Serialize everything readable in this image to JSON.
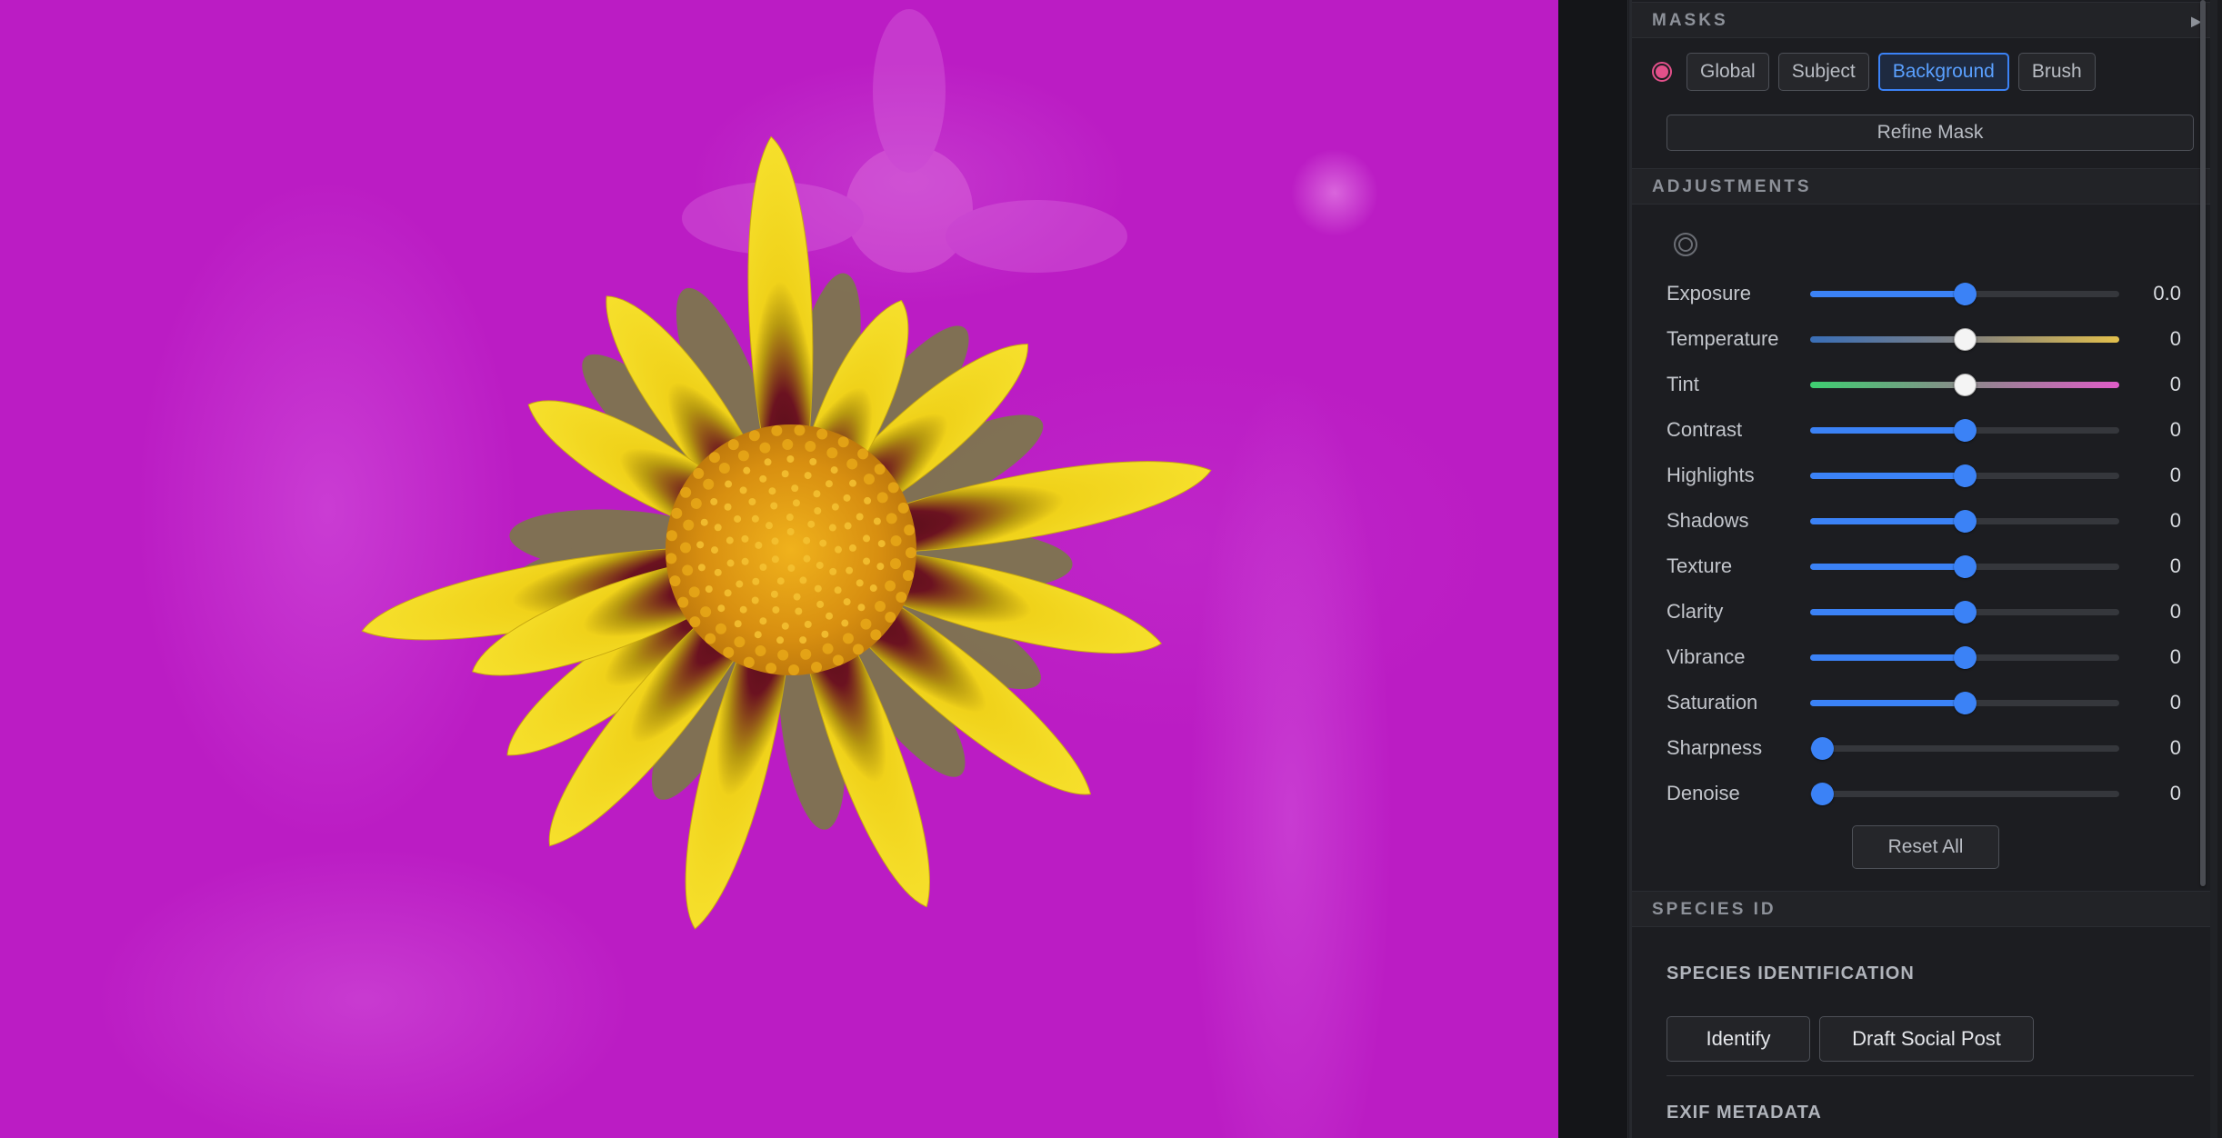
{
  "masks": {
    "header": "MASKS",
    "collapse_icon": "▶",
    "types": [
      "Global",
      "Subject",
      "Background",
      "Brush"
    ],
    "active_type": "Background",
    "refine_label": "Refine Mask",
    "mask_color": "#e2508a"
  },
  "adjustments": {
    "header": "ADJUSTMENTS",
    "icon": "radial-target-icon",
    "items": [
      {
        "label": "Exposure",
        "value": "0.0",
        "level": 0.5,
        "style": "blue"
      },
      {
        "label": "Temperature",
        "value": "0",
        "level": 0.5,
        "style": "temp"
      },
      {
        "label": "Tint",
        "value": "0",
        "level": 0.5,
        "style": "tint"
      },
      {
        "label": "Contrast",
        "value": "0",
        "level": 0.5,
        "style": "blue"
      },
      {
        "label": "Highlights",
        "value": "0",
        "level": 0.5,
        "style": "blue"
      },
      {
        "label": "Shadows",
        "value": "0",
        "level": 0.5,
        "style": "blue"
      },
      {
        "label": "Texture",
        "value": "0",
        "level": 0.5,
        "style": "blue"
      },
      {
        "label": "Clarity",
        "value": "0",
        "level": 0.5,
        "style": "blue"
      },
      {
        "label": "Vibrance",
        "value": "0",
        "level": 0.5,
        "style": "blue"
      },
      {
        "label": "Saturation",
        "value": "0",
        "level": 0.5,
        "style": "blue"
      },
      {
        "label": "Sharpness",
        "value": "0",
        "level": 0.0,
        "style": "blue"
      },
      {
        "label": "Denoise",
        "value": "0",
        "level": 0.0,
        "style": "blue"
      }
    ],
    "reset_label": "Reset All",
    "accent": "#3b82f6"
  },
  "species": {
    "header": "SPECIES ID",
    "title": "SPECIES IDENTIFICATION",
    "identify_label": "Identify",
    "draft_label": "Draft Social Post"
  },
  "exif": {
    "title": "EXIF METADATA"
  },
  "canvas": {
    "background_overlay": "#bb1cc4",
    "petal_color": "#f2d316",
    "petal_base_color": "#5a0f1a",
    "center_color": "#e0a414"
  }
}
